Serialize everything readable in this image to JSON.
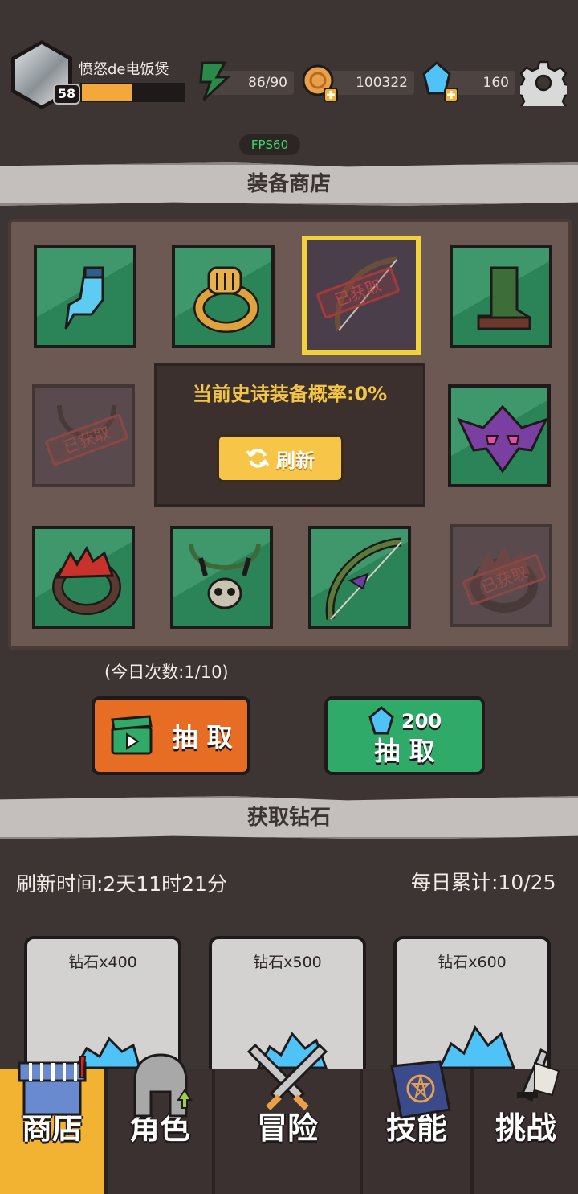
{
  "player": {
    "name": "愤怒de电饭煲",
    "level": "58",
    "xp_fraction": 0.5
  },
  "resources": {
    "energy": "86/90",
    "coins": "100322",
    "gems": "160"
  },
  "fps": "FPS60",
  "shop": {
    "title": "装备商店",
    "epic_chance": "当前史诗装备概率:0%",
    "refresh_label": "刷新",
    "taken_label": "已获取",
    "items": [
      {
        "name": "ice-boot-icon",
        "state": "available"
      },
      {
        "name": "gold-ring-icon",
        "state": "available"
      },
      {
        "name": "vine-bow-icon",
        "state": "taken-selected"
      },
      {
        "name": "leather-boot-icon",
        "state": "available"
      },
      {
        "name": "bone-necklace-icon",
        "state": "taken"
      },
      {
        "name": "bat-helmet-icon",
        "state": "available"
      },
      {
        "name": "red-ring-icon",
        "state": "available"
      },
      {
        "name": "skull-necklace-icon",
        "state": "available"
      },
      {
        "name": "vine-bow-icon",
        "state": "available"
      },
      {
        "name": "red-ring-icon",
        "state": "taken"
      }
    ],
    "today_count": "(今日次数:1/10)",
    "draw_label": "抽 取",
    "gem_draw_cost": "200",
    "gem_draw_label": "抽 取"
  },
  "gems_section": {
    "title": "获取钻石",
    "refresh_time": "刷新时间:2天11时21分",
    "daily_total": "每日累计:10/25",
    "cards": [
      {
        "label": "钻石x400"
      },
      {
        "label": "钻石x500"
      },
      {
        "label": "钻石x600"
      }
    ]
  },
  "nav": {
    "tabs": [
      {
        "label": "商店",
        "icon": "shop-icon",
        "active": true
      },
      {
        "label": "角色",
        "icon": "helmet-icon",
        "active": false
      },
      {
        "label": "冒险",
        "icon": "crossed-swords-icon",
        "active": false
      },
      {
        "label": "技能",
        "icon": "spellbook-icon",
        "active": false
      },
      {
        "label": "挑战",
        "icon": "sword-flag-icon",
        "active": false
      }
    ]
  },
  "colors": {
    "accent": "#f2b333",
    "panel": "#6c5953",
    "slot": "#2e8f5f",
    "gem": "#4fc3f7"
  }
}
